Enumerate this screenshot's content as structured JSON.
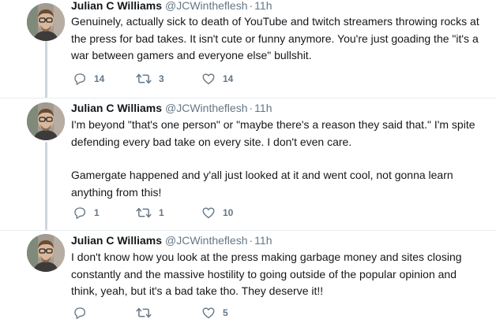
{
  "tweets": [
    {
      "name": "Julian C Williams",
      "handle": "@JCWintheflesh",
      "separator": "·",
      "time": "11h",
      "paragraphs": [
        "Genuinely, actually sick to death of YouTube and twitch streamers throwing rocks at the press for bad takes. It isn't cute or funny anymore. You're just goading the \"it's a war between gamers and everyone else\" bullshit."
      ],
      "replies": "14",
      "retweets": "3",
      "likes": "14"
    },
    {
      "name": "Julian C Williams",
      "handle": "@JCWintheflesh",
      "separator": "·",
      "time": "11h",
      "paragraphs": [
        "I'm beyond \"that's one person\" or \"maybe there's a reason they said that.\" I'm spite defending every bad take on every site. I don't even care.",
        "Gamergate happened and y'all just looked at it and went cool, not gonna learn anything from this!"
      ],
      "replies": "1",
      "retweets": "1",
      "likes": "10"
    },
    {
      "name": "Julian C Williams",
      "handle": "@JCWintheflesh",
      "separator": "·",
      "time": "11h",
      "paragraphs": [
        "I don't know how you look at the press making garbage money and sites closing constantly and the massive hostility to going outside of the popular opinion and think, yeah, but it's a bad take tho. They deserve it!!"
      ],
      "replies": "",
      "retweets": "",
      "likes": "5"
    }
  ],
  "icons": {
    "reply": "reply-icon",
    "retweet": "retweet-icon",
    "like": "heart-icon"
  },
  "colors": {
    "text": "#14171a",
    "secondary": "#657786",
    "thread_line": "#ccd6dd",
    "divider": "#e6ecf0"
  }
}
